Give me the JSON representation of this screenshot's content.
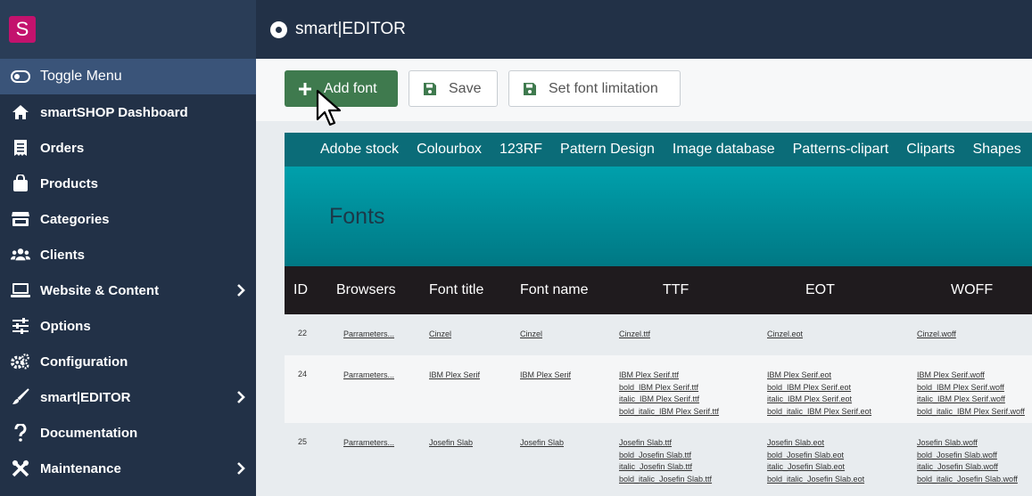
{
  "app": {
    "logo_letter": "S",
    "title": "smart|EDITOR"
  },
  "sidebar": {
    "toggle_label": "Toggle Menu",
    "items": [
      {
        "label": "smartSHOP Dashboard",
        "icon": "home-icon",
        "has_children": false
      },
      {
        "label": "Orders",
        "icon": "receipt-icon",
        "has_children": false
      },
      {
        "label": "Products",
        "icon": "shopping-bag-icon",
        "has_children": false
      },
      {
        "label": "Categories",
        "icon": "store-icon",
        "has_children": false
      },
      {
        "label": "Clients",
        "icon": "users-icon",
        "has_children": false
      },
      {
        "label": "Website & Content",
        "icon": "laptop-icon",
        "has_children": true
      },
      {
        "label": "Options",
        "icon": "sliders-icon",
        "has_children": false
      },
      {
        "label": "Configuration",
        "icon": "cogs-icon",
        "has_children": false
      },
      {
        "label": "smart|EDITOR",
        "icon": "brush-icon",
        "has_children": true
      },
      {
        "label": "Documentation",
        "icon": "question-icon",
        "has_children": false
      },
      {
        "label": "Maintenance",
        "icon": "tools-icon",
        "has_children": true
      }
    ]
  },
  "toolbar": {
    "add_label": "Add font",
    "save_label": "Save",
    "limit_label": "Set font limitation"
  },
  "category_nav": [
    "Adobe stock",
    "Colourbox",
    "123RF",
    "Pattern Design",
    "Image database",
    "Patterns-clipart",
    "Cliparts",
    "Shapes"
  ],
  "banner_title": "Fonts",
  "table": {
    "headers": [
      "ID",
      "Browsers",
      "Font title",
      "Font name",
      "TTF",
      "EOT",
      "WOFF"
    ],
    "rows": [
      {
        "id": "22",
        "browsers": "Parrameters...",
        "title": "Cinzel",
        "name": "Cinzel",
        "ttf": [
          "Cinzel.ttf"
        ],
        "eot": [
          "Cinzel.eot"
        ],
        "woff": [
          "Cinzel.woff"
        ]
      },
      {
        "id": "24",
        "browsers": "Parrameters...",
        "title": "IBM Plex Serif",
        "name": "IBM Plex Serif",
        "ttf": [
          "IBM Plex Serif.ttf",
          "bold_IBM Plex Serif.ttf",
          "italic_IBM Plex Serif.ttf",
          "bold_italic_IBM Plex Serif.ttf"
        ],
        "eot": [
          "IBM Plex Serif.eot",
          "bold_IBM Plex Serif.eot",
          "italic_IBM Plex Serif.eot",
          "bold_italic_IBM Plex Serif.eot"
        ],
        "woff": [
          "IBM Plex Serif.woff",
          "bold_IBM Plex Serif.woff",
          "italic_IBM Plex Serif.woff",
          "bold_italic_IBM Plex Serif.woff"
        ]
      },
      {
        "id": "25",
        "browsers": "Parrameters...",
        "title": "Josefin Slab",
        "name": "Josefin Slab",
        "ttf": [
          "Josefin Slab.ttf",
          "bold_Josefin Slab.ttf",
          "italic_Josefin Slab.ttf",
          "bold_italic_Josefin Slab.ttf"
        ],
        "eot": [
          "Josefin Slab.eot",
          "bold_Josefin Slab.eot",
          "italic_Josefin Slab.eot",
          "bold_italic_Josefin Slab.eot"
        ],
        "woff": [
          "Josefin Slab.woff",
          "bold_Josefin Slab.woff",
          "italic_Josefin Slab.woff",
          "bold_italic_Josefin Slab.woff"
        ]
      }
    ]
  },
  "colors": {
    "sidebar_bg": "#223147",
    "accent_green": "#3f7a4e",
    "brand_pink": "#c3126d",
    "teal_nav": "#0b6c78"
  }
}
